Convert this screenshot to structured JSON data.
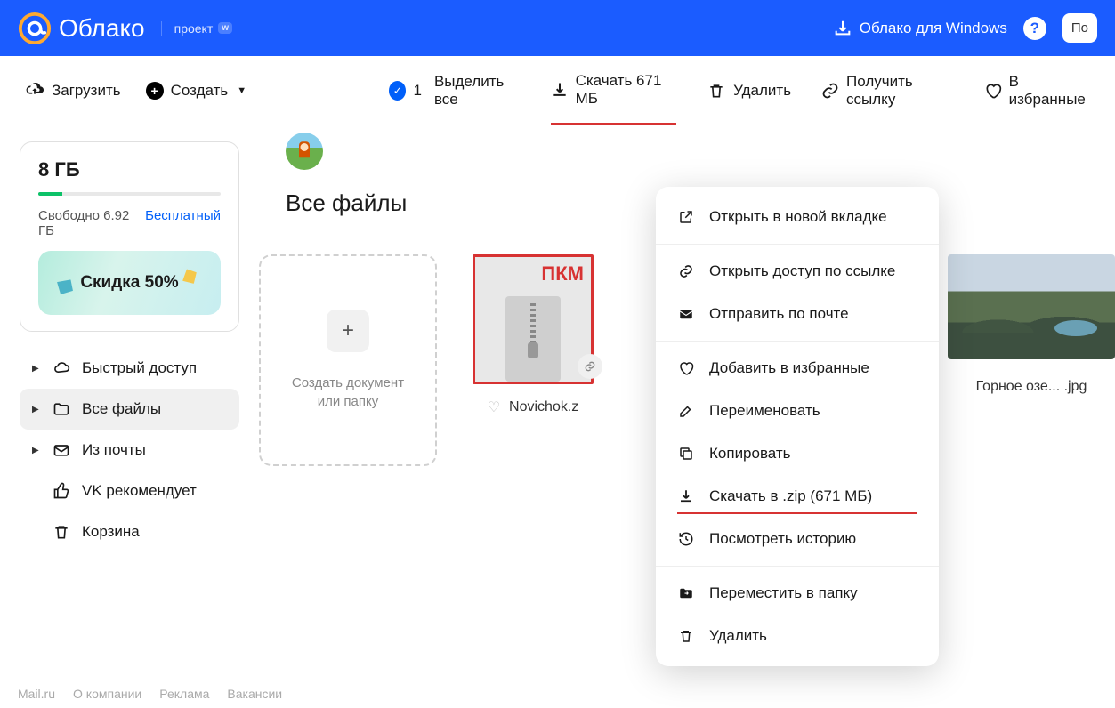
{
  "header": {
    "logo_text": "Облако",
    "project_label": "проект",
    "windows_label": "Облако для Windows",
    "search_stub": "По"
  },
  "toolbar": {
    "upload": "Загрузить",
    "create": "Создать",
    "selected_count": "1",
    "select_all": "Выделить все",
    "download": "Скачать 671 МБ",
    "delete": "Удалить",
    "get_link": "Получить ссылку",
    "favorites": "В избранные"
  },
  "sidebar": {
    "storage_title": "8 ГБ",
    "free_label": "Свободно 6.92 ГБ",
    "plan_label": "Бесплатный",
    "promo_label": "Скидка 50%",
    "nav": [
      {
        "label": "Быстрый доступ",
        "icon": "cloud",
        "caret": true,
        "active": false
      },
      {
        "label": "Все файлы",
        "icon": "folder",
        "caret": true,
        "active": true
      },
      {
        "label": "Из почты",
        "icon": "mail",
        "caret": true,
        "active": false
      },
      {
        "label": "VK рекомендует",
        "icon": "thumbs-up",
        "caret": false,
        "active": false
      },
      {
        "label": "Корзина",
        "icon": "trash",
        "caret": false,
        "active": false
      }
    ]
  },
  "content": {
    "section_title": "Все файлы",
    "create_tile_line1": "Создать документ",
    "create_tile_line2": "или папку",
    "zip_badge": "ПКМ",
    "zip_filename": "Novichok.z",
    "image_filename": "Горное озе... .jpg"
  },
  "context_menu": {
    "groups": [
      [
        {
          "icon": "open-new",
          "label": "Открыть в новой вкладке"
        }
      ],
      [
        {
          "icon": "link",
          "label": "Открыть доступ по ссылке"
        },
        {
          "icon": "mail-solid",
          "label": "Отправить по почте"
        }
      ],
      [
        {
          "icon": "heart",
          "label": "Добавить в избранные"
        },
        {
          "icon": "rename",
          "label": "Переименовать"
        },
        {
          "icon": "copy",
          "label": "Копировать"
        },
        {
          "icon": "download",
          "label": "Скачать в .zip (671 МБ)",
          "underline": true
        },
        {
          "icon": "history",
          "label": "Посмотреть историю"
        }
      ],
      [
        {
          "icon": "move",
          "label": "Переместить в папку"
        },
        {
          "icon": "trash",
          "label": "Удалить"
        }
      ]
    ]
  },
  "footer": {
    "links": [
      "Mail.ru",
      "О компании",
      "Реклама",
      "Вакансии"
    ]
  }
}
